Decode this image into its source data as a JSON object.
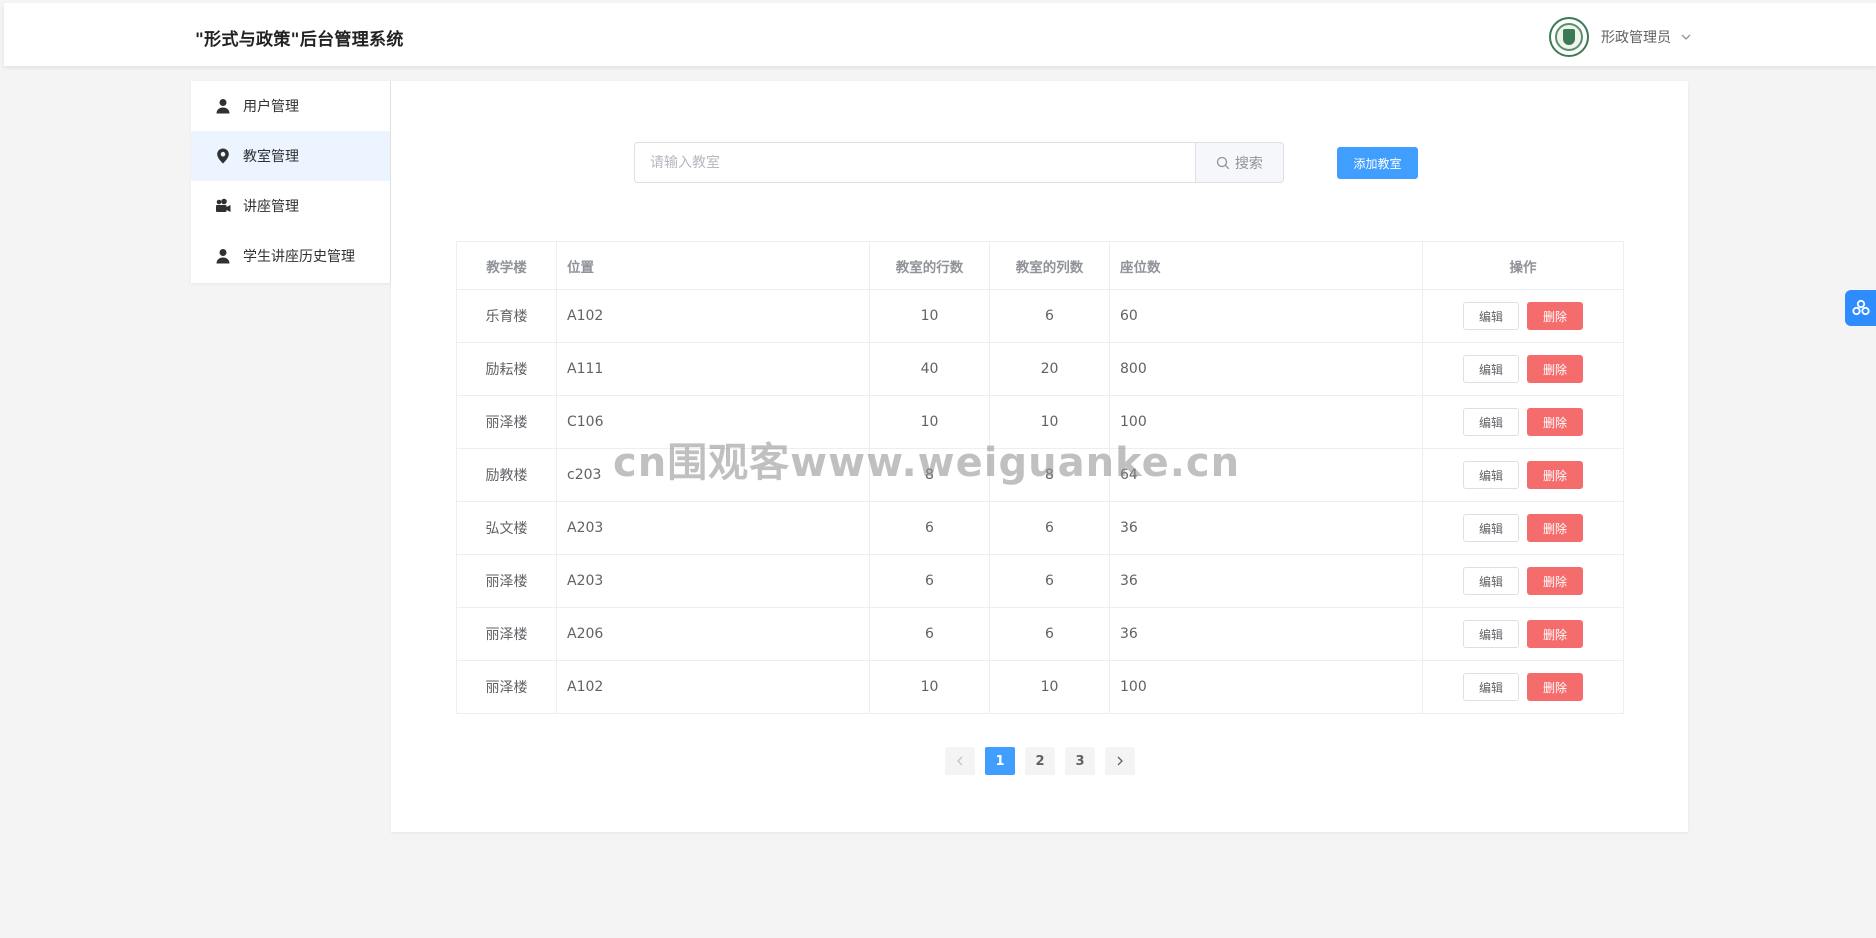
{
  "header": {
    "title": "\"形式与政策\"后台管理系统",
    "user_name": "形政管理员"
  },
  "sidebar": {
    "items": [
      {
        "label": "用户管理",
        "icon": "user-icon"
      },
      {
        "label": "教室管理",
        "icon": "location-icon"
      },
      {
        "label": "讲座管理",
        "icon": "camera-icon"
      },
      {
        "label": "学生讲座历史管理",
        "icon": "user-icon"
      }
    ],
    "active_index": 1
  },
  "search": {
    "placeholder": "请输入教室",
    "button_label": "搜索"
  },
  "add_button_label": "添加教室",
  "table": {
    "headers": [
      "教学楼",
      "位置",
      "教室的行数",
      "教室的列数",
      "座位数",
      "操作"
    ],
    "rows": [
      [
        "乐育楼",
        "A102",
        "10",
        "6",
        "60"
      ],
      [
        "励耘楼",
        "A111",
        "40",
        "20",
        "800"
      ],
      [
        "丽泽楼",
        "C106",
        "10",
        "10",
        "100"
      ],
      [
        "励教楼",
        "c203",
        "8",
        "8",
        "64"
      ],
      [
        "弘文楼",
        "A203",
        "6",
        "6",
        "36"
      ],
      [
        "丽泽楼",
        "A203",
        "6",
        "6",
        "36"
      ],
      [
        "丽泽楼",
        "A206",
        "6",
        "6",
        "36"
      ],
      [
        "丽泽楼",
        "A102",
        "10",
        "10",
        "100"
      ]
    ],
    "edit_label": "编辑",
    "delete_label": "删除"
  },
  "pagination": {
    "pages": [
      "1",
      "2",
      "3"
    ],
    "current": "1"
  },
  "watermark": "cn围观客www.weiguanke.cn",
  "colors": {
    "primary": "#409eff",
    "danger": "#f56c6c",
    "active_bg": "#ecf5ff"
  }
}
